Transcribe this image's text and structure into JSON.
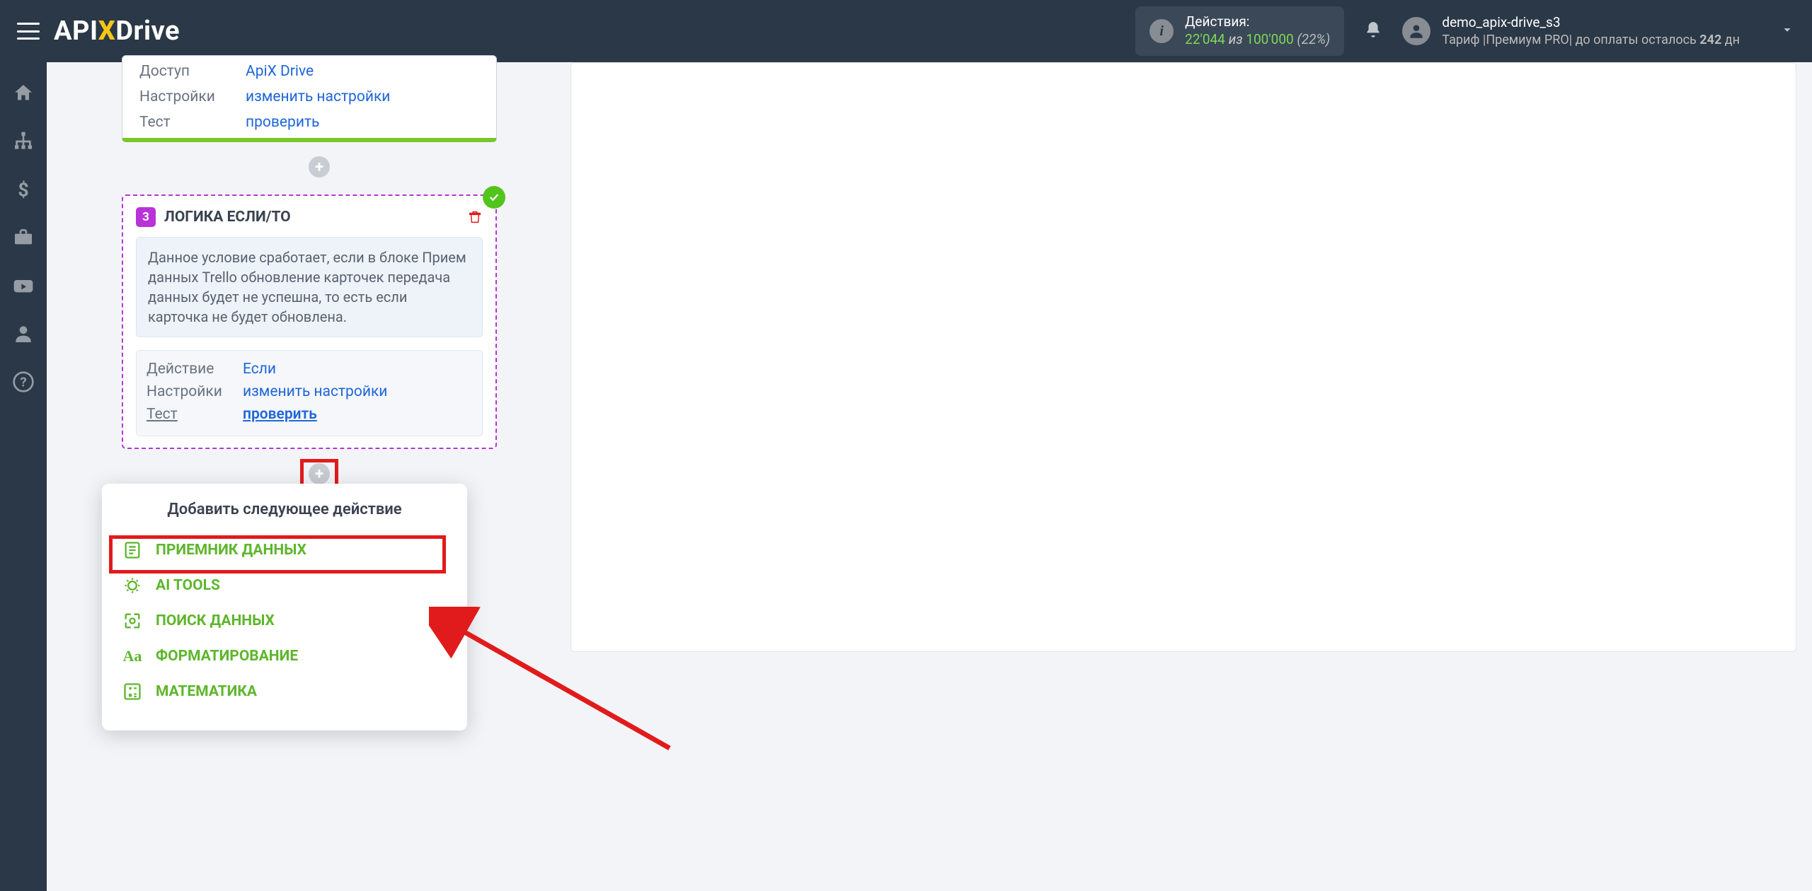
{
  "header": {
    "actions_label": "Действия:",
    "actions_used": "22'044",
    "actions_of": "из",
    "actions_total": "100'000",
    "actions_pct": "(22%)",
    "user_name": "demo_apix-drive_s3",
    "tariff_text": "Тариф |Премиум PRO| до оплаты осталось ",
    "tariff_days": "242",
    "tariff_suffix": " дн"
  },
  "card1": {
    "rows": [
      {
        "k": "Доступ",
        "v": "ApiX Drive"
      },
      {
        "k": "Настройки",
        "v": "изменить настройки"
      },
      {
        "k": "Тест",
        "v": "проверить"
      }
    ]
  },
  "card2": {
    "step": "3",
    "title": "ЛОГИКА ЕСЛИ/ТО",
    "note": "Данное условие сработает, если в блоке Прием данных Trello обновление карточек передача данных будет не успешна, то есть если карточка не будет обновлена.",
    "rows": [
      {
        "k": "Действие",
        "v": "Если"
      },
      {
        "k": "Настройки",
        "v": "изменить настройки"
      },
      {
        "k": "Тест",
        "v": "проверить"
      }
    ]
  },
  "popup": {
    "title": "Добавить следующее действие",
    "items": [
      "ПРИЕМНИК ДАННЫХ",
      "AI TOOLS",
      "ПОИСК ДАННЫХ",
      "ФОРМАТИРОВАНИЕ",
      "МАТЕМАТИКА"
    ]
  }
}
